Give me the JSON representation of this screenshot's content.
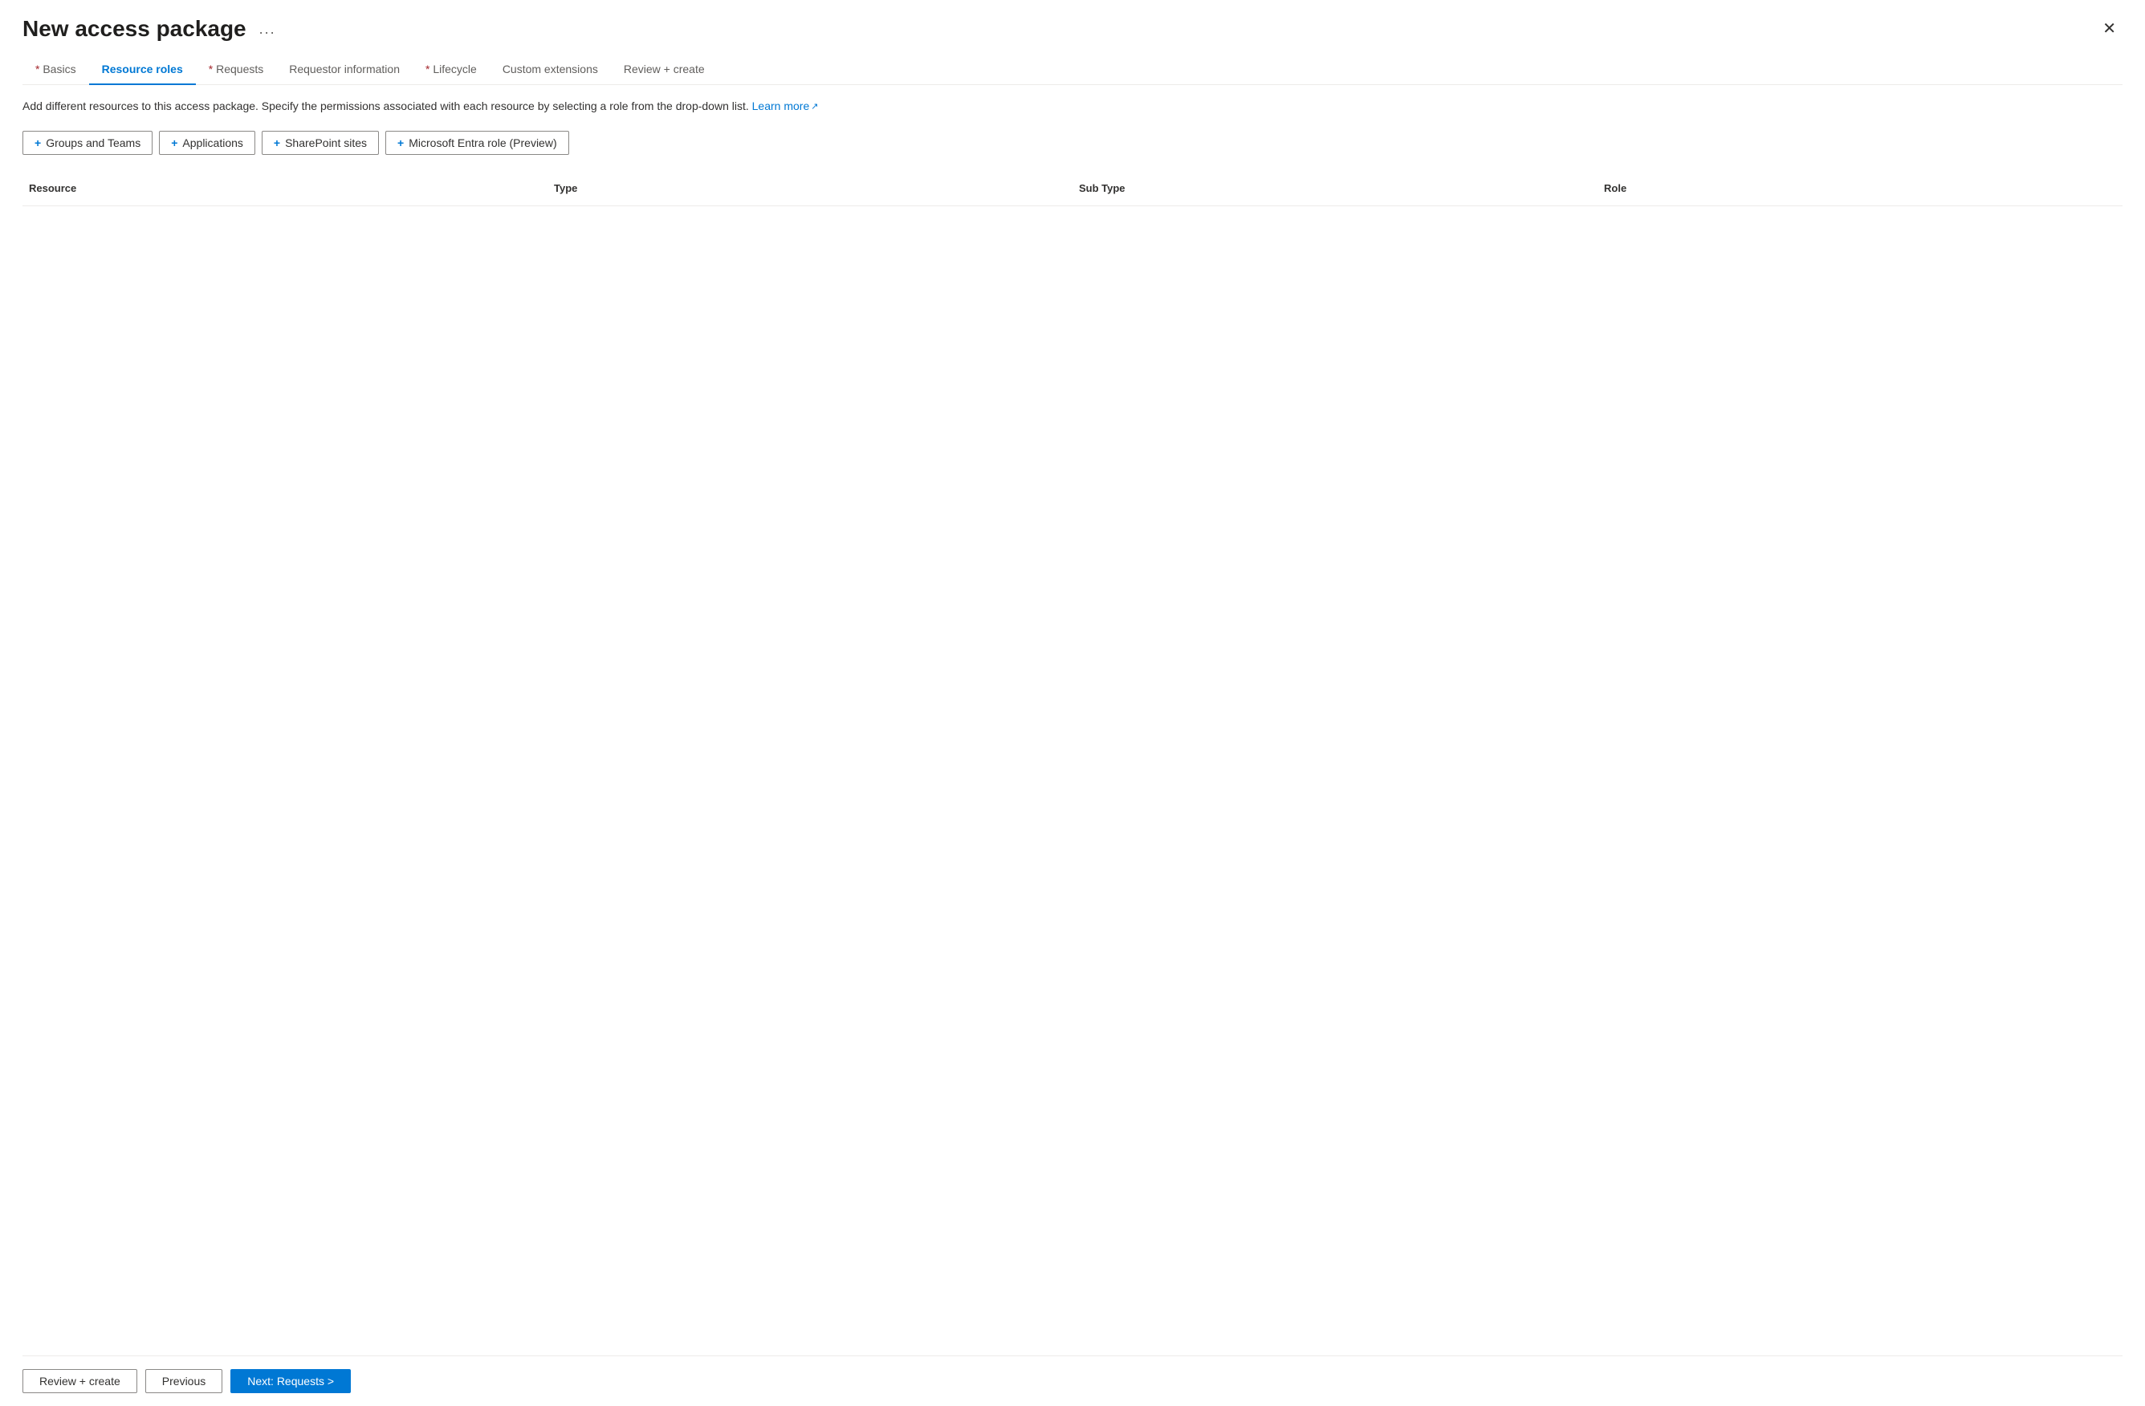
{
  "header": {
    "title": "New access package",
    "ellipsis_label": "...",
    "close_label": "✕"
  },
  "tabs": [
    {
      "id": "basics",
      "label": "Basics",
      "required": true,
      "active": false
    },
    {
      "id": "resource-roles",
      "label": "Resource roles",
      "required": false,
      "active": true
    },
    {
      "id": "requests",
      "label": "Requests",
      "required": true,
      "active": false
    },
    {
      "id": "requestor-information",
      "label": "Requestor information",
      "required": false,
      "active": false
    },
    {
      "id": "lifecycle",
      "label": "Lifecycle",
      "required": true,
      "active": false
    },
    {
      "id": "custom-extensions",
      "label": "Custom extensions",
      "required": false,
      "active": false
    },
    {
      "id": "review-create",
      "label": "Review + create",
      "required": false,
      "active": false
    }
  ],
  "description": {
    "text": "Add different resources to this access package. Specify the permissions associated with each resource by selecting a role from the drop-down list.",
    "learn_more_label": "Learn more",
    "learn_more_icon": "↗"
  },
  "resource_buttons": [
    {
      "id": "groups-teams",
      "label": "Groups and Teams",
      "plus": "+"
    },
    {
      "id": "applications",
      "label": "Applications",
      "plus": "+"
    },
    {
      "id": "sharepoint-sites",
      "label": "SharePoint sites",
      "plus": "+"
    },
    {
      "id": "microsoft-entra-role",
      "label": "Microsoft Entra role (Preview)",
      "plus": "+"
    }
  ],
  "table": {
    "columns": [
      "Resource",
      "Type",
      "Sub Type",
      "Role"
    ],
    "rows": []
  },
  "footer": {
    "review_create_label": "Review + create",
    "previous_label": "Previous",
    "next_label": "Next: Requests >"
  }
}
